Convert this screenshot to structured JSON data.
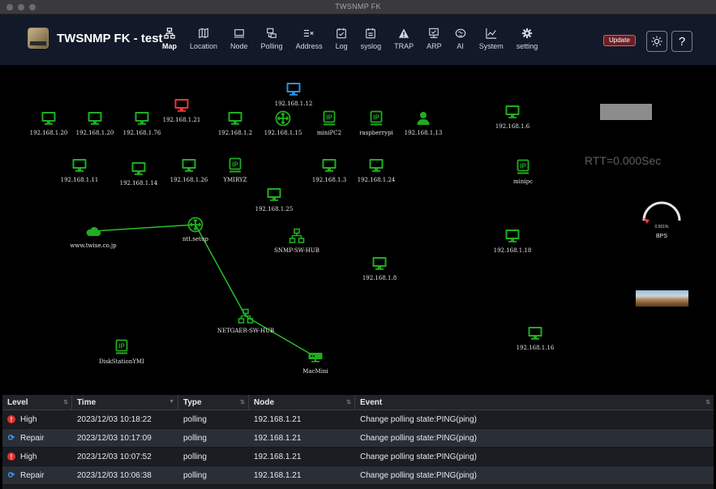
{
  "window": {
    "title": "TWSNMP FK"
  },
  "app": {
    "title": "TWSNMP FK - test"
  },
  "menu": [
    {
      "id": "map",
      "label": "Map",
      "icon": "map-icon"
    },
    {
      "id": "location",
      "label": "Location",
      "icon": "location-icon"
    },
    {
      "id": "node",
      "label": "Node",
      "icon": "node-icon"
    },
    {
      "id": "polling",
      "label": "Polling",
      "icon": "polling-icon"
    },
    {
      "id": "address",
      "label": "Address",
      "icon": "address-icon"
    },
    {
      "id": "log",
      "label": "Log",
      "icon": "log-icon"
    },
    {
      "id": "syslog",
      "label": "syslog",
      "icon": "syslog-icon"
    },
    {
      "id": "trap",
      "label": "TRAP",
      "icon": "trap-icon"
    },
    {
      "id": "arp",
      "label": "ARP",
      "icon": "arp-icon"
    },
    {
      "id": "ai",
      "label": "AI",
      "icon": "ai-icon"
    },
    {
      "id": "system",
      "label": "System",
      "icon": "system-icon"
    },
    {
      "id": "setting",
      "label": "setting",
      "icon": "gear-icon"
    }
  ],
  "toolbar": {
    "update_label": "Update",
    "help_label": "?"
  },
  "colors": {
    "ok": "#1fae1f",
    "high": "#e53935",
    "unknown": "#2f8fd8",
    "line": "#26c026",
    "repair": "#3ea0ff"
  },
  "map": {
    "nodes": [
      {
        "id": "n1",
        "label": "192.168.1.20",
        "type": "pc",
        "state": "ok"
      },
      {
        "id": "n2",
        "label": "192.168.1.20",
        "type": "pc",
        "state": "ok"
      },
      {
        "id": "n3",
        "label": "192.168.1.76",
        "type": "pc",
        "state": "ok"
      },
      {
        "id": "n4",
        "label": "192.168.1.21",
        "type": "pc",
        "state": "high"
      },
      {
        "id": "n5",
        "label": "192.168.1.2",
        "type": "pc",
        "state": "ok"
      },
      {
        "id": "n6",
        "label": "192.168.1.15",
        "type": "router",
        "state": "ok"
      },
      {
        "id": "n7",
        "label": "192.168.1.12",
        "type": "pc",
        "state": "unknown"
      },
      {
        "id": "n8",
        "label": "miniPC2",
        "type": "ip",
        "state": "ok"
      },
      {
        "id": "n9",
        "label": "raspberrypi",
        "type": "ip",
        "state": "ok"
      },
      {
        "id": "n10",
        "label": "192.168.1.13",
        "type": "user",
        "state": "ok"
      },
      {
        "id": "n11",
        "label": "192.168.1.6",
        "type": "pc",
        "state": "ok"
      },
      {
        "id": "n12",
        "label": "192.168.1.11",
        "type": "pc",
        "state": "ok"
      },
      {
        "id": "n13",
        "label": "192.168.1.14",
        "type": "pc",
        "state": "ok"
      },
      {
        "id": "n14",
        "label": "192.168.1.26",
        "type": "pc",
        "state": "ok"
      },
      {
        "id": "n15",
        "label": "YMIRYZ",
        "type": "ip",
        "state": "ok"
      },
      {
        "id": "n16",
        "label": "192.168.1.3",
        "type": "pc",
        "state": "ok"
      },
      {
        "id": "n17",
        "label": "192.168.1.24",
        "type": "pc",
        "state": "ok"
      },
      {
        "id": "n18",
        "label": "minipc",
        "type": "ip",
        "state": "ok"
      },
      {
        "id": "n19",
        "label": "192.168.1.25",
        "type": "pc",
        "state": "ok"
      },
      {
        "id": "n20",
        "label": "www.twise.co.jp",
        "type": "cloud",
        "state": "ok"
      },
      {
        "id": "n21",
        "label": "ntt.setup",
        "type": "router",
        "state": "ok"
      },
      {
        "id": "n22",
        "label": "SNMP-SW-HUB",
        "type": "hub",
        "state": "ok"
      },
      {
        "id": "n23",
        "label": "192.168.1.18",
        "type": "pc",
        "state": "ok"
      },
      {
        "id": "n24",
        "label": "192.168.1.8",
        "type": "pc",
        "state": "ok"
      },
      {
        "id": "n25",
        "label": "NETGAER-SW-HUB",
        "type": "hub",
        "state": "ok"
      },
      {
        "id": "n26",
        "label": "DiskStationYMI",
        "type": "ip",
        "state": "ok"
      },
      {
        "id": "n27",
        "label": "MacMini",
        "type": "server",
        "state": "ok"
      },
      {
        "id": "n28",
        "label": "192.168.1.16",
        "type": "pc",
        "state": "ok"
      }
    ],
    "links": [
      {
        "from": "n20",
        "to": "n21"
      },
      {
        "from": "n21",
        "to": "n25"
      },
      {
        "from": "n25",
        "to": "n27"
      }
    ],
    "rtt_text": "RTT=0.000Sec",
    "gauge": {
      "value_text": "0.001%",
      "label": "BPS",
      "value": 0.001
    }
  },
  "events": {
    "columns": [
      "Level",
      "Time",
      "Type",
      "Node",
      "Event"
    ],
    "rows": [
      {
        "level": "High",
        "level_icon": "alert-icon",
        "time": "2023/12/03 10:18:22",
        "type": "polling",
        "node": "192.168.1.21",
        "event": "Change polling state:PING(ping)"
      },
      {
        "level": "Repair",
        "level_icon": "repair-icon",
        "time": "2023/12/03 10:17:09",
        "type": "polling",
        "node": "192.168.1.21",
        "event": "Change polling state:PING(ping)"
      },
      {
        "level": "High",
        "level_icon": "alert-icon",
        "time": "2023/12/03 10:07:52",
        "type": "polling",
        "node": "192.168.1.21",
        "event": "Change polling state:PING(ping)"
      },
      {
        "level": "Repair",
        "level_icon": "repair-icon",
        "time": "2023/12/03 10:06:38",
        "type": "polling",
        "node": "192.168.1.21",
        "event": "Change polling state:PING(ping)"
      }
    ]
  }
}
